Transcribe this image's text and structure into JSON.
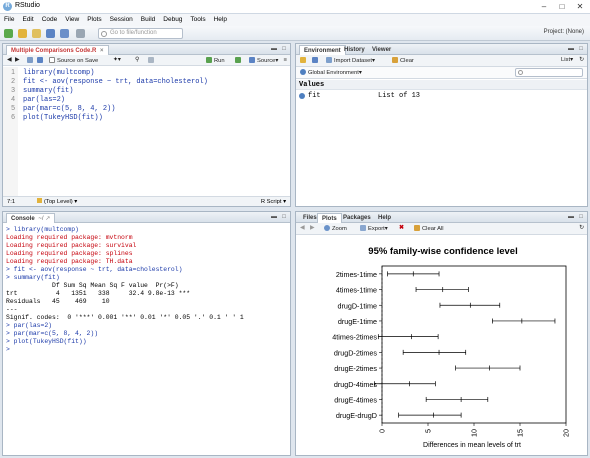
{
  "window": {
    "title": "RStudio"
  },
  "menu": [
    "File",
    "Edit",
    "Code",
    "View",
    "Plots",
    "Session",
    "Build",
    "Debug",
    "Tools",
    "Help"
  ],
  "toolbar": {
    "goto_placeholder": "Go to file/function",
    "project": "Project: (None)"
  },
  "editor": {
    "tab": "Multiple Comparisons Code.R",
    "source_on_save": "Source on Save",
    "run": "Run",
    "source": "Source",
    "line_numbers": [
      "1",
      "2",
      "3",
      "4",
      "5",
      "6"
    ],
    "lines": [
      "library(multcomp)",
      "fit <- aov(response ~ trt, data=cholesterol)",
      "summary(fit)",
      "par(las=2)",
      "par(mar=c(5, 8, 4, 2))",
      "plot(TukeyHSD(fit))"
    ],
    "cursor": "7:1",
    "scope": "(Top Level)",
    "filetype": "R Script"
  },
  "environment": {
    "tabs": [
      "Environment",
      "History",
      "Viewer"
    ],
    "import_dataset": "Import Dataset",
    "clear": "Clear",
    "list_view": "List",
    "scope": "Global Environment",
    "section": "Values",
    "rows": [
      {
        "name": "fit",
        "value": "List of 13"
      }
    ]
  },
  "console": {
    "title": "Console",
    "path": "~/",
    "lines": [
      {
        "t": "> library(multcomp)",
        "k": "cmd"
      },
      {
        "t": "Loading required package: mvtnorm",
        "k": "err"
      },
      {
        "t": "Loading required package: survival",
        "k": "err"
      },
      {
        "t": "Loading required package: splines",
        "k": "err"
      },
      {
        "t": "Loading required package: TH.data",
        "k": "err"
      },
      {
        "t": "> fit <- aov(response ~ trt, data=cholesterol)",
        "k": "cmd"
      },
      {
        "t": "> summary(fit)",
        "k": "cmd"
      },
      {
        "t": "            Df Sum Sq Mean Sq F value  Pr(>F)",
        "k": "out"
      },
      {
        "t": "trt          4   1351   338     32.4 9.8e-13 ***",
        "k": "out"
      },
      {
        "t": "Residuals   45    469    10",
        "k": "out"
      },
      {
        "t": "---",
        "k": "out"
      },
      {
        "t": "Signif. codes:  0 '***' 0.001 '**' 0.01 '*' 0.05 '.' 0.1 ' ' 1",
        "k": "out"
      },
      {
        "t": "> par(las=2)",
        "k": "cmd"
      },
      {
        "t": "> par(mar=c(5, 8, 4, 2))",
        "k": "cmd"
      },
      {
        "t": "> plot(TukeyHSD(fit))",
        "k": "cmd"
      },
      {
        "t": ">",
        "k": "cmd"
      }
    ]
  },
  "plots": {
    "tabs": [
      "Files",
      "Plots",
      "Packages",
      "Help"
    ],
    "zoom": "Zoom",
    "export": "Export",
    "clear_all": "Clear All"
  },
  "chart_data": {
    "type": "interval",
    "title": "95% family-wise confidence level",
    "xlabel": "Differences in mean levels of trt",
    "xlim": [
      0,
      20
    ],
    "xticks": [
      0,
      5,
      10,
      15,
      20
    ],
    "comparisons": [
      {
        "label": "2times-1time",
        "lwr": 0.6,
        "est": 3.4,
        "upr": 6.2
      },
      {
        "label": "4times-1time",
        "lwr": 3.7,
        "est": 6.6,
        "upr": 9.4
      },
      {
        "label": "drugD-1time",
        "lwr": 6.3,
        "est": 9.6,
        "upr": 12.8
      },
      {
        "label": "drugE-1time",
        "lwr": 12.0,
        "est": 15.2,
        "upr": 18.8
      },
      {
        "label": "4times-2times",
        "lwr": -0.4,
        "est": 3.2,
        "upr": 6.1
      },
      {
        "label": "drugD-2times",
        "lwr": 2.3,
        "est": 6.2,
        "upr": 9.1
      },
      {
        "label": "drugE-2times",
        "lwr": 8.0,
        "est": 11.7,
        "upr": 15.0
      },
      {
        "label": "drugD-4times",
        "lwr": -0.8,
        "est": 3.0,
        "upr": 5.8
      },
      {
        "label": "drugE-4times",
        "lwr": 4.8,
        "est": 8.6,
        "upr": 11.5
      },
      {
        "label": "drugE-drugD",
        "lwr": 1.8,
        "est": 5.6,
        "upr": 8.6
      }
    ]
  }
}
